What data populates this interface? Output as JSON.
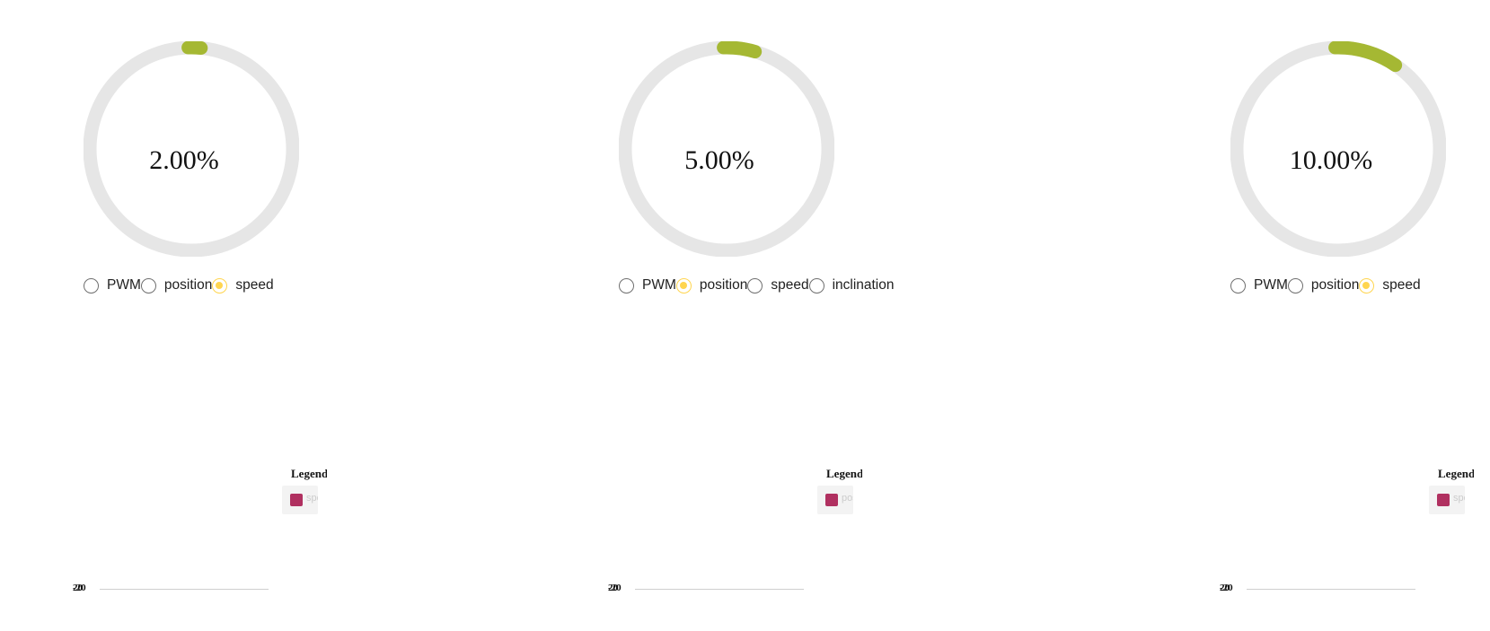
{
  "panels": [
    {
      "percent_text": "2.00%",
      "fraction": 0.02,
      "modes": [
        {
          "label": "PWM",
          "checked": false
        },
        {
          "label": "position",
          "checked": false
        },
        {
          "label": "speed",
          "checked": true
        }
      ],
      "legend_title": "Legend",
      "legend_item": "speed",
      "axis_labels": [
        "-20",
        "20"
      ]
    },
    {
      "percent_text": "5.00%",
      "fraction": 0.05,
      "modes": [
        {
          "label": "PWM",
          "checked": false
        },
        {
          "label": "position",
          "checked": true
        },
        {
          "label": "speed",
          "checked": false
        },
        {
          "label": "inclination",
          "checked": false
        }
      ],
      "legend_title": "Legend",
      "legend_item": "position",
      "axis_labels": [
        "-20",
        "20"
      ]
    },
    {
      "percent_text": "10.00%",
      "fraction": 0.1,
      "modes": [
        {
          "label": "PWM",
          "checked": false
        },
        {
          "label": "position",
          "checked": false
        },
        {
          "label": "speed",
          "checked": true
        }
      ],
      "legend_title": "Legend",
      "legend_item": "speed",
      "axis_labels": [
        "-20",
        "20"
      ]
    }
  ],
  "colors": {
    "gauge_track": "#e6e6e6",
    "gauge_progress": "#a5b833",
    "radio_selected": "#ffd54f",
    "legend_swatch": "#b03060"
  }
}
